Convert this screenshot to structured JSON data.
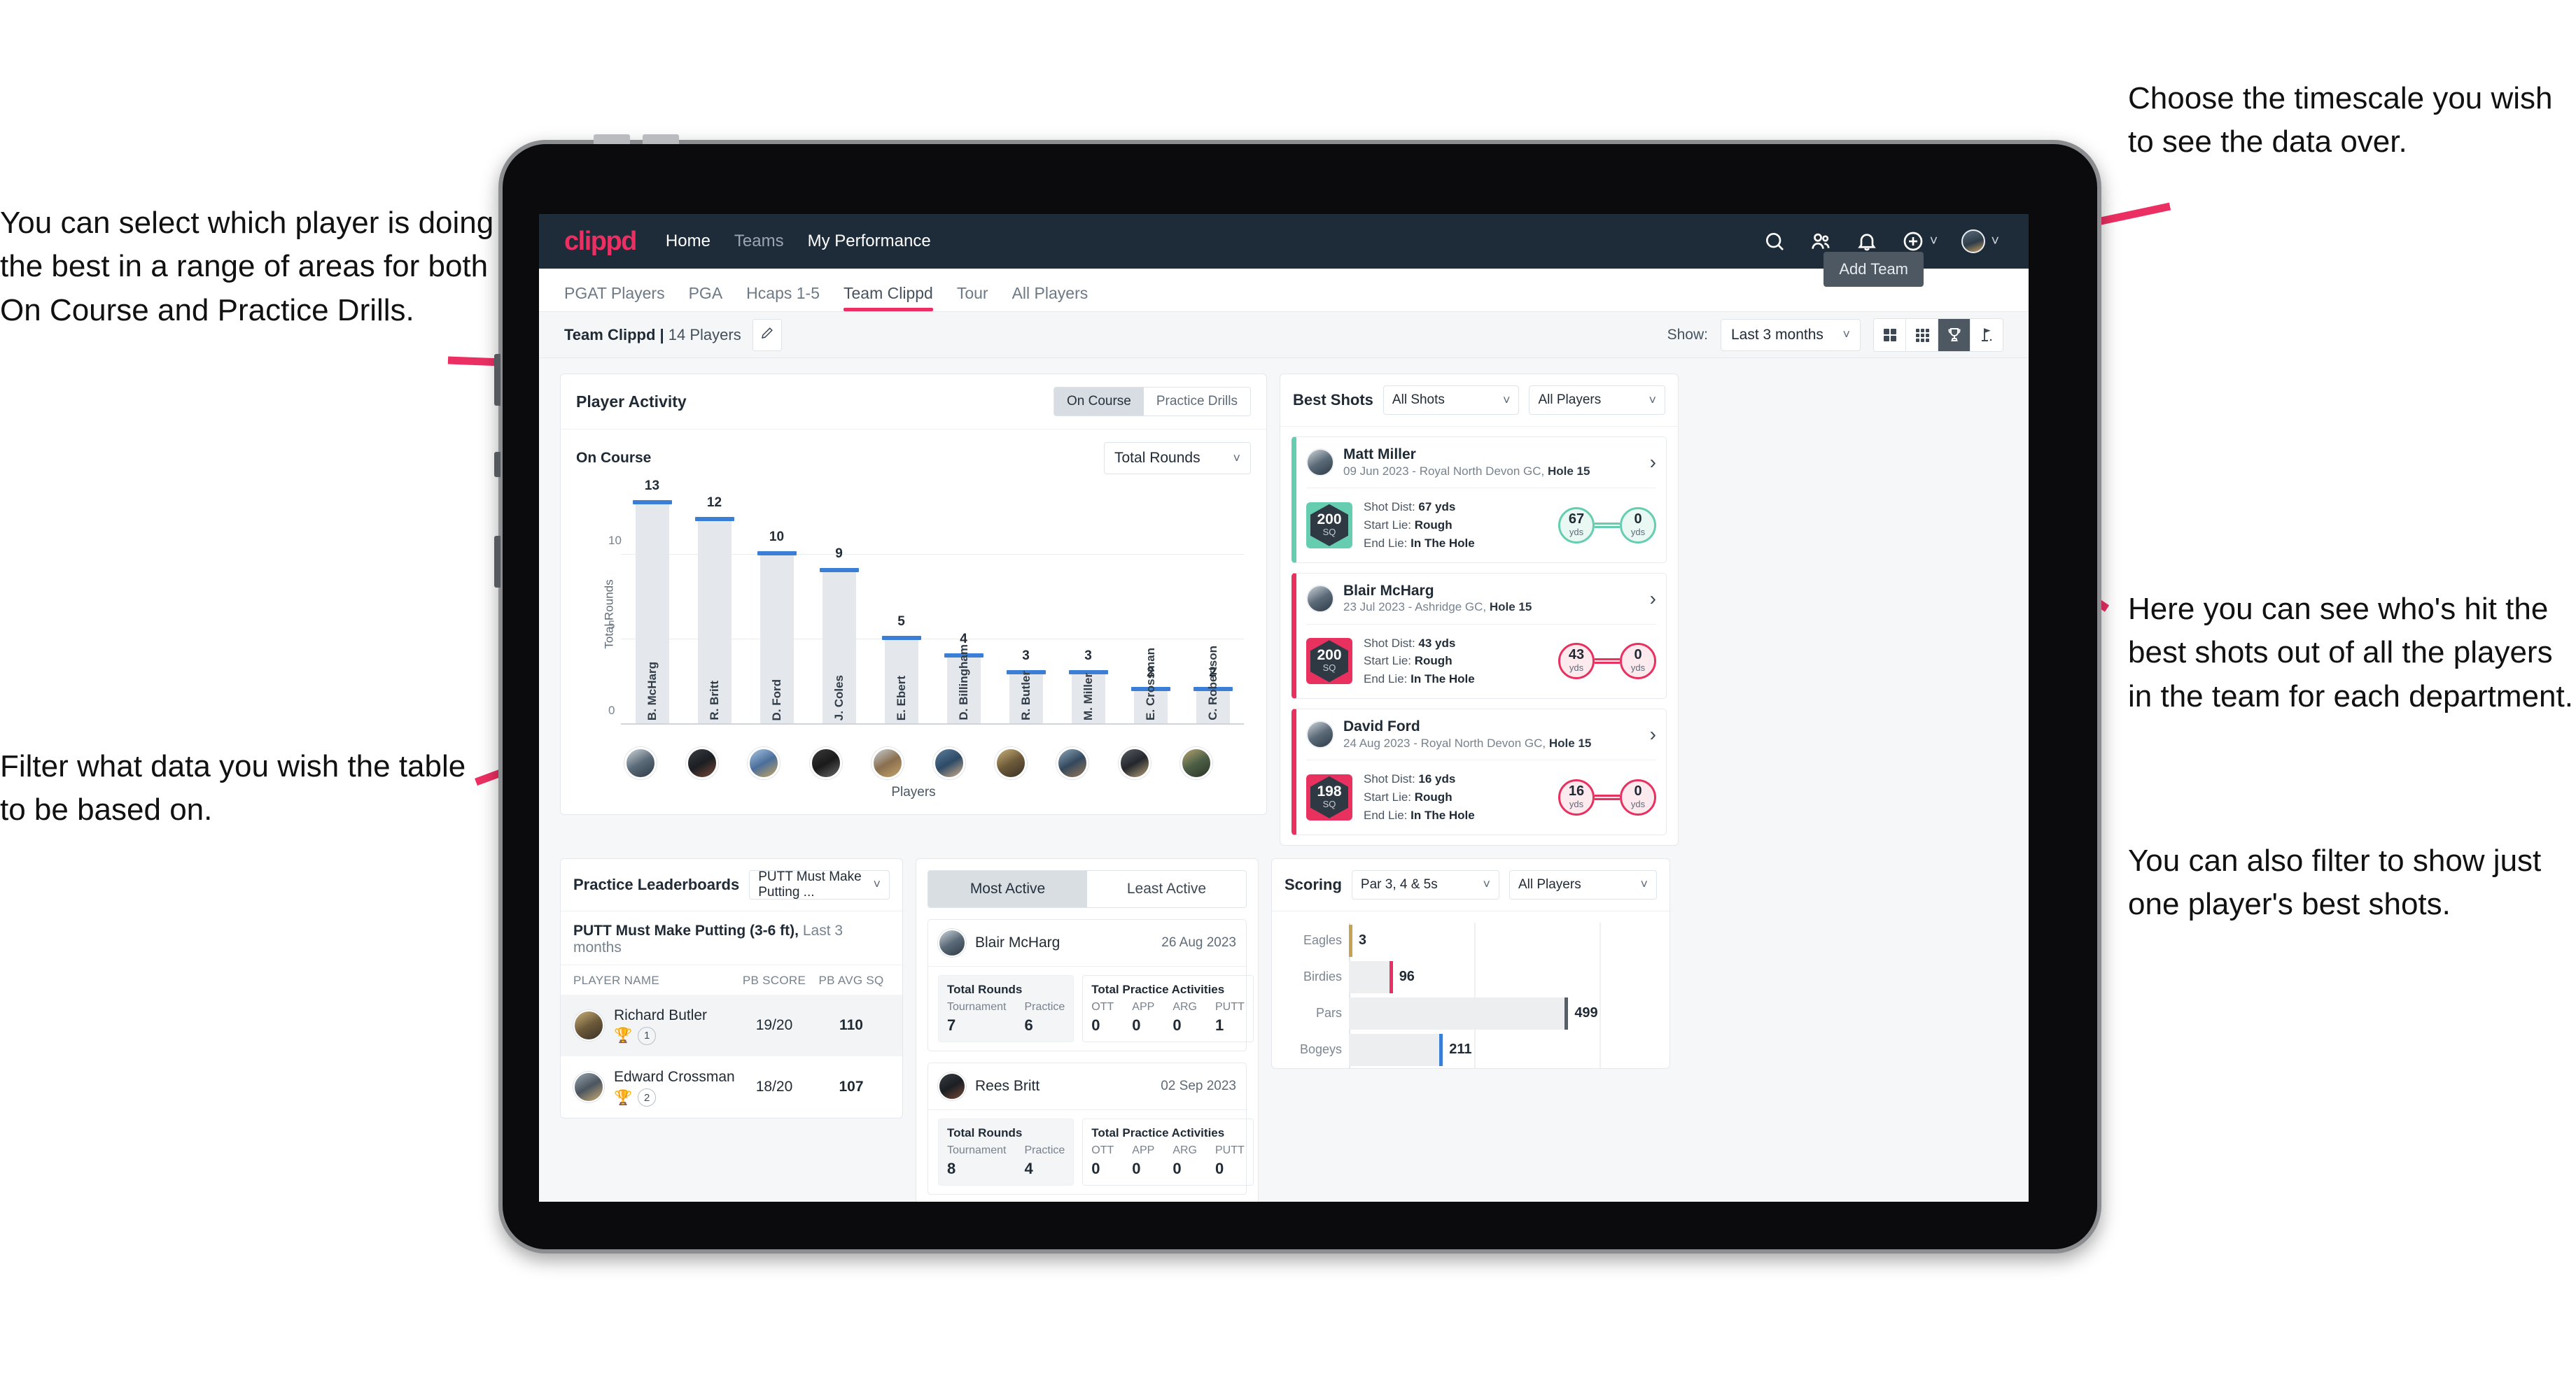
{
  "annotations": {
    "left_top": "You can select which player is doing the best in a range of areas for both On Course and Practice Drills.",
    "left_bottom": "Filter what data you wish the table to be based on.",
    "right_top": "Choose the timescale you wish to see the data over.",
    "right_mid": "Here you can see who's hit the best shots out of all the players in the team for each department.",
    "right_bottom": "You can also filter to show just one player's best shots."
  },
  "navbar": {
    "logo": "clippd",
    "links": [
      {
        "label": "Home",
        "dim": false
      },
      {
        "label": "Teams",
        "dim": true
      },
      {
        "label": "My Performance",
        "dim": false
      }
    ],
    "icons": [
      "search-icon",
      "people-icon",
      "bell-icon",
      "plus-circle-icon",
      "avatar"
    ]
  },
  "subtabs": {
    "items": [
      {
        "label": "PGAT Players",
        "active": false
      },
      {
        "label": "PGA",
        "active": false
      },
      {
        "label": "Hcaps 1-5",
        "active": false
      },
      {
        "label": "Team Clippd",
        "active": true
      },
      {
        "label": "Tour",
        "active": false
      },
      {
        "label": "All Players",
        "active": false
      }
    ],
    "add_team_button": "Add Team"
  },
  "toolbar": {
    "team_label_bold": "Team Clippd |",
    "team_label_thin": " 14 Players",
    "edit_icon": "pencil-icon",
    "show_label": "Show:",
    "timescale_value": "Last 3 months",
    "view_modes": [
      {
        "name": "grid-2x2-icon",
        "active": false
      },
      {
        "name": "grid-3x3-icon",
        "active": false
      },
      {
        "name": "trophy-icon",
        "active": true
      },
      {
        "name": "golf-flag-icon",
        "active": false
      }
    ]
  },
  "player_activity": {
    "title": "Player Activity",
    "segments": [
      {
        "label": "On Course",
        "active": true
      },
      {
        "label": "Practice Drills",
        "active": false
      }
    ],
    "subtitle": "On Course",
    "metric_select": "Total Rounds",
    "x_axis_label": "Players"
  },
  "best_shots": {
    "title": "Best Shots",
    "filter_shots": "All Shots",
    "filter_players": "All Players",
    "cards": [
      {
        "player": "Matt Miller",
        "meta_plain": "09 Jun 2023 - Royal North Devon GC, ",
        "meta_bold": "Hole 15",
        "badge_num": "200",
        "badge_sub": "SQ",
        "accent": "#66cdb0",
        "shot_dist_label": "Shot Dist: ",
        "shot_dist": "67 yds",
        "start_lie_label": "Start Lie: ",
        "start_lie": "Rough",
        "end_lie_label": "End Lie: ",
        "end_lie": "In The Hole",
        "left_num": "67",
        "left_unit": "yds",
        "right_num": "0",
        "right_unit": "yds"
      },
      {
        "player": "Blair McHarg",
        "meta_plain": "23 Jul 2023 - Ashridge GC, ",
        "meta_bold": "Hole 15",
        "badge_num": "200",
        "badge_sub": "SQ",
        "accent": "#e8315f",
        "shot_dist_label": "Shot Dist: ",
        "shot_dist": "43 yds",
        "start_lie_label": "Start Lie: ",
        "start_lie": "Rough",
        "end_lie_label": "End Lie: ",
        "end_lie": "In The Hole",
        "left_num": "43",
        "left_unit": "yds",
        "right_num": "0",
        "right_unit": "yds"
      },
      {
        "player": "David Ford",
        "meta_plain": "24 Aug 2023 - Royal North Devon GC, ",
        "meta_bold": "Hole 15",
        "badge_num": "198",
        "badge_sub": "SQ",
        "accent": "#e8315f",
        "shot_dist_label": "Shot Dist: ",
        "shot_dist": "16 yds",
        "start_lie_label": "Start Lie: ",
        "start_lie": "Rough",
        "end_lie_label": "End Lie: ",
        "end_lie": "In The Hole",
        "left_num": "16",
        "left_unit": "yds",
        "right_num": "0",
        "right_unit": "yds"
      }
    ]
  },
  "practice_leaderboards": {
    "title": "Practice Leaderboards",
    "drill_select": "PUTT Must Make Putting ...",
    "subtitle_bold": "PUTT Must Make Putting (3-6 ft),",
    "subtitle_thin": " Last 3 months",
    "columns": [
      "PLAYER NAME",
      "PB SCORE",
      "PB AVG SQ"
    ],
    "rows": [
      {
        "name": "Richard Butler",
        "rank": "1",
        "trophy": "gold",
        "pb_score": "19/20",
        "pb_avg_sq": "110",
        "highlight": true
      },
      {
        "name": "Edward Crossman",
        "rank": "2",
        "trophy": "silver",
        "pb_score": "18/20",
        "pb_avg_sq": "107",
        "highlight": false
      }
    ]
  },
  "activity_panel": {
    "tabs": [
      {
        "label": "Most Active",
        "active": true
      },
      {
        "label": "Least Active",
        "active": false
      }
    ],
    "cards": [
      {
        "player": "Blair McHarg",
        "date": "26 Aug 2023",
        "rounds_title": "Total Rounds",
        "rounds": [
          {
            "k": "Tournament",
            "v": "7"
          },
          {
            "k": "Practice",
            "v": "6"
          }
        ],
        "practice_title": "Total Practice Activities",
        "practice": [
          {
            "k": "OTT",
            "v": "0"
          },
          {
            "k": "APP",
            "v": "0"
          },
          {
            "k": "ARG",
            "v": "0"
          },
          {
            "k": "PUTT",
            "v": "1"
          }
        ]
      },
      {
        "player": "Rees Britt",
        "date": "02 Sep 2023",
        "rounds_title": "Total Rounds",
        "rounds": [
          {
            "k": "Tournament",
            "v": "8"
          },
          {
            "k": "Practice",
            "v": "4"
          }
        ],
        "practice_title": "Total Practice Activities",
        "practice": [
          {
            "k": "OTT",
            "v": "0"
          },
          {
            "k": "APP",
            "v": "0"
          },
          {
            "k": "ARG",
            "v": "0"
          },
          {
            "k": "PUTT",
            "v": "0"
          }
        ]
      }
    ]
  },
  "scoring": {
    "title": "Scoring",
    "filter_par": "Par 3, 4 & 5s",
    "filter_players": "All Players"
  },
  "chart_data": [
    {
      "type": "bar",
      "title": "Player Activity - On Course",
      "xlabel": "Players",
      "ylabel": "Total Rounds",
      "ylim": [
        0,
        13
      ],
      "yticks": [
        0,
        5,
        10
      ],
      "grid": true,
      "categories": [
        "B. McHarg",
        "R. Britt",
        "D. Ford",
        "J. Coles",
        "E. Ebert",
        "D. Billingham",
        "R. Butler",
        "M. Miller",
        "E. Crossman",
        "C. Robertson"
      ],
      "values": [
        13,
        12,
        10,
        9,
        5,
        4,
        3,
        3,
        2,
        2
      ],
      "bar_color": "#e4e7eb",
      "cap_color": "#3a7fd5"
    },
    {
      "type": "bar",
      "orientation": "horizontal",
      "title": "Scoring",
      "categories": [
        "Eagles",
        "Birdies",
        "Pars",
        "Bogeys"
      ],
      "values": [
        3,
        96,
        499,
        211
      ],
      "cap_colors": [
        "#c6a253",
        "#ec2f62",
        "#565f68",
        "#3a7fd5"
      ],
      "xlim": [
        0,
        640
      ],
      "grid": true
    }
  ]
}
